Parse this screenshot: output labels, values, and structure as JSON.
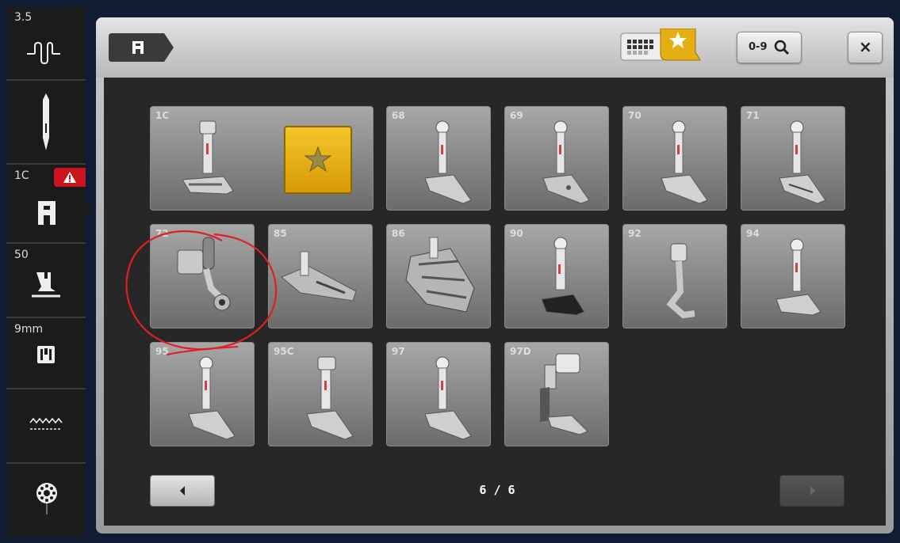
{
  "sidebar": {
    "stitch_width": "3.5",
    "foot_label": "1C",
    "presser_pressure": "50",
    "stitch_plate": "9mm"
  },
  "header": {
    "search_label": "0-9",
    "close_label": "×"
  },
  "feet": [
    {
      "num": "1C"
    },
    {
      "num": "68"
    },
    {
      "num": "69"
    },
    {
      "num": "70"
    },
    {
      "num": "71"
    },
    {
      "num": "72"
    },
    {
      "num": "85"
    },
    {
      "num": "86"
    },
    {
      "num": "90"
    },
    {
      "num": "92"
    },
    {
      "num": "94"
    },
    {
      "num": "95"
    },
    {
      "num": "95C"
    },
    {
      "num": "97"
    },
    {
      "num": "97D"
    }
  ],
  "pager": {
    "label": "6 / 6"
  },
  "colors": {
    "warning_red": "#c9151d",
    "favorite_gold": "#e5ae12",
    "annotation_red": "#e01e26"
  },
  "icons": {
    "stitch_width": "stitch-width-icon",
    "needle": "needle-icon",
    "presser_foot": "presser-foot-icon",
    "warning": "warning-icon",
    "pressure": "foot-pressure-icon",
    "stitch_plate": "stitch-plate-icon",
    "feed_dog": "feed-dog-icon",
    "bobbin": "bobbin-icon"
  }
}
